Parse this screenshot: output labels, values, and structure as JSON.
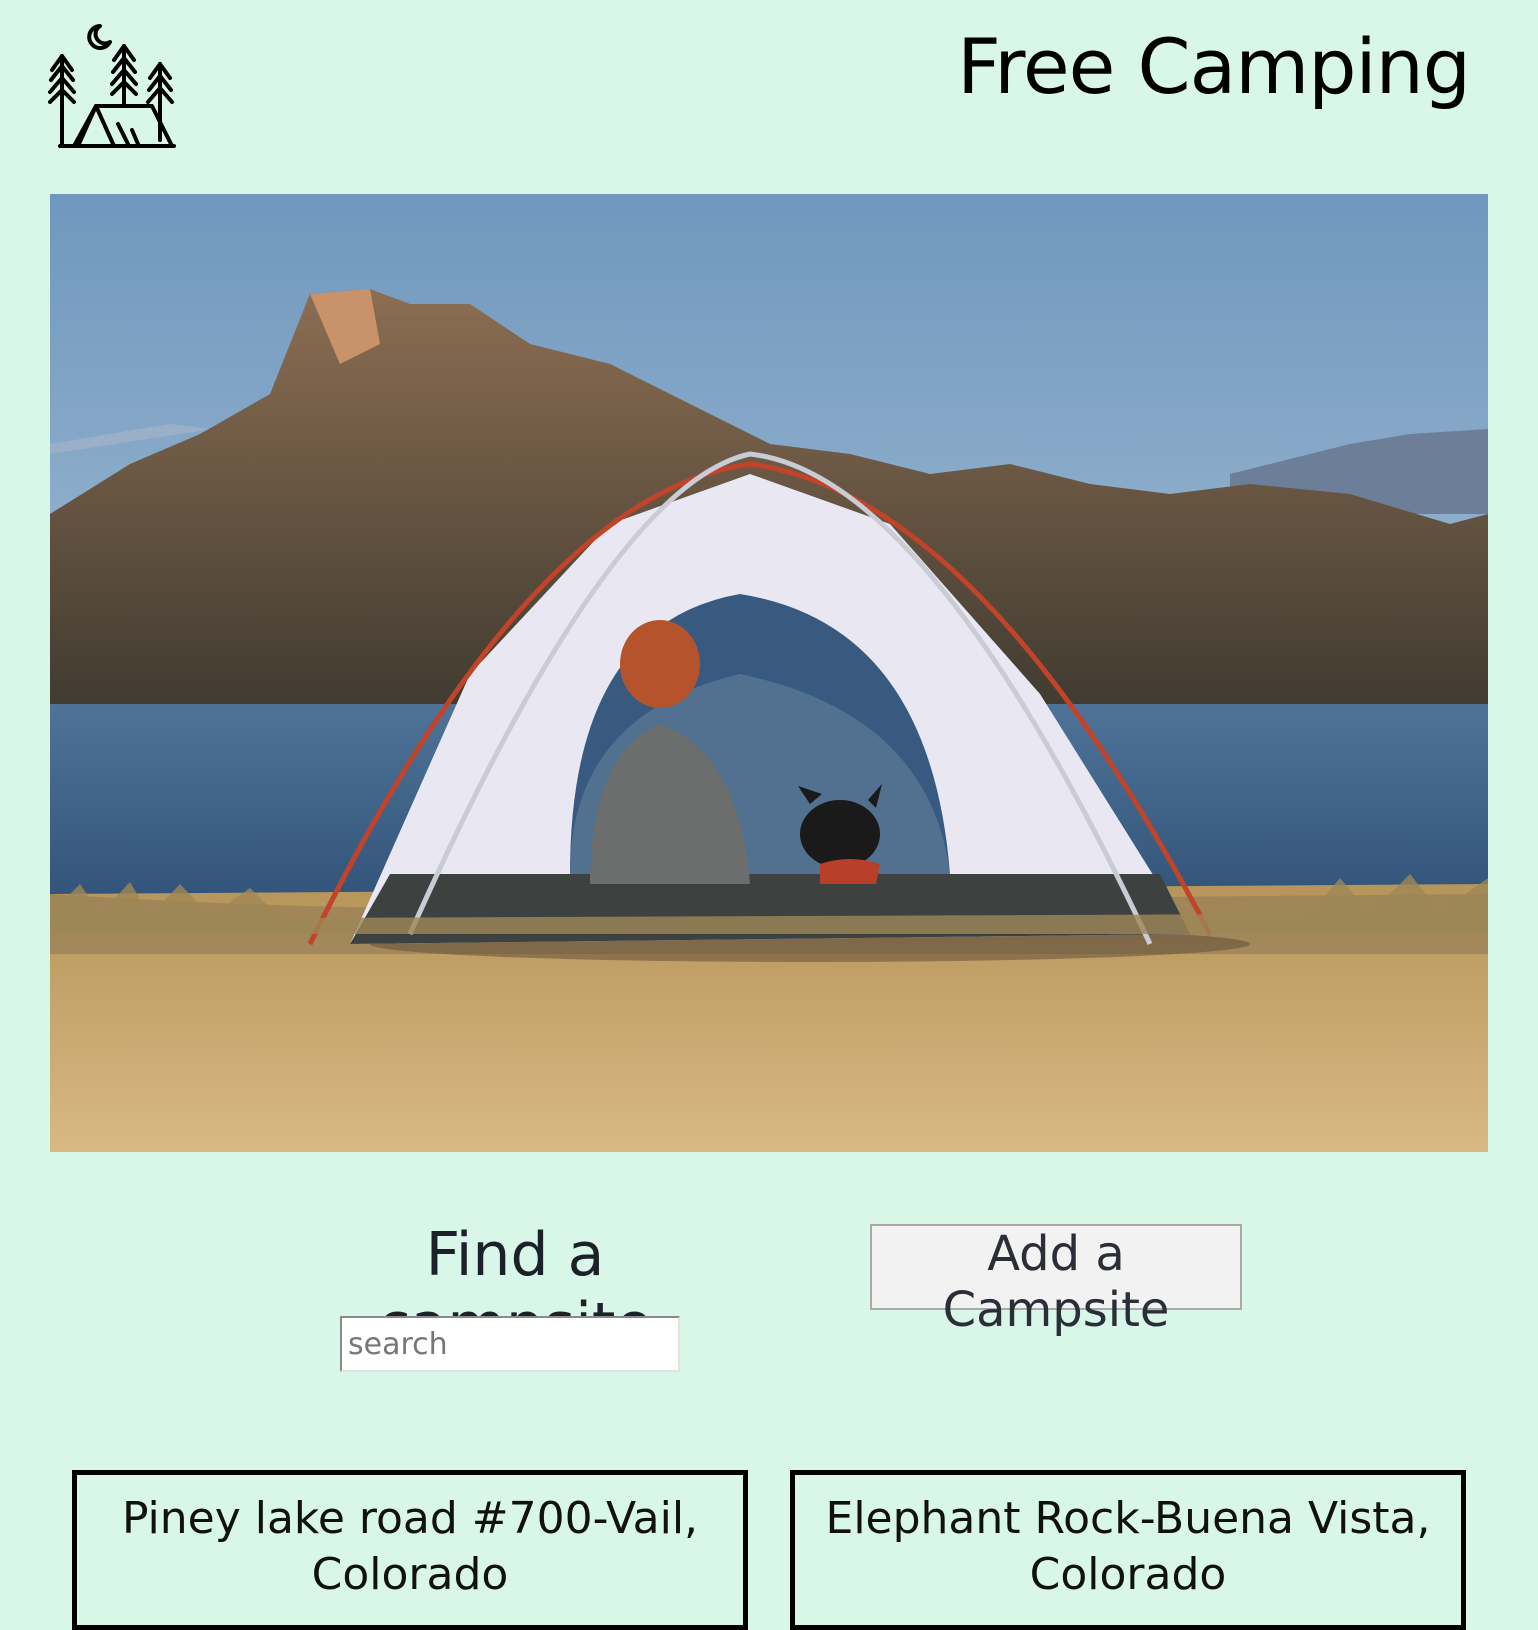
{
  "header": {
    "title": "Free Camping",
    "logo_icon": "camping-tent-trees-moon-icon"
  },
  "hero": {
    "image_subject": "hero-photo"
  },
  "find": {
    "title": "Find a campsite",
    "search_placeholder": "search"
  },
  "actions": {
    "add_label": "Add a Campsite"
  },
  "campsites": [
    {
      "name": "Piney lake road #700-Vail, Colorado"
    },
    {
      "name": "Elephant Rock-Buena Vista, Colorado"
    }
  ],
  "colors": {
    "background": "#d8f7e8",
    "text": "#000000"
  }
}
